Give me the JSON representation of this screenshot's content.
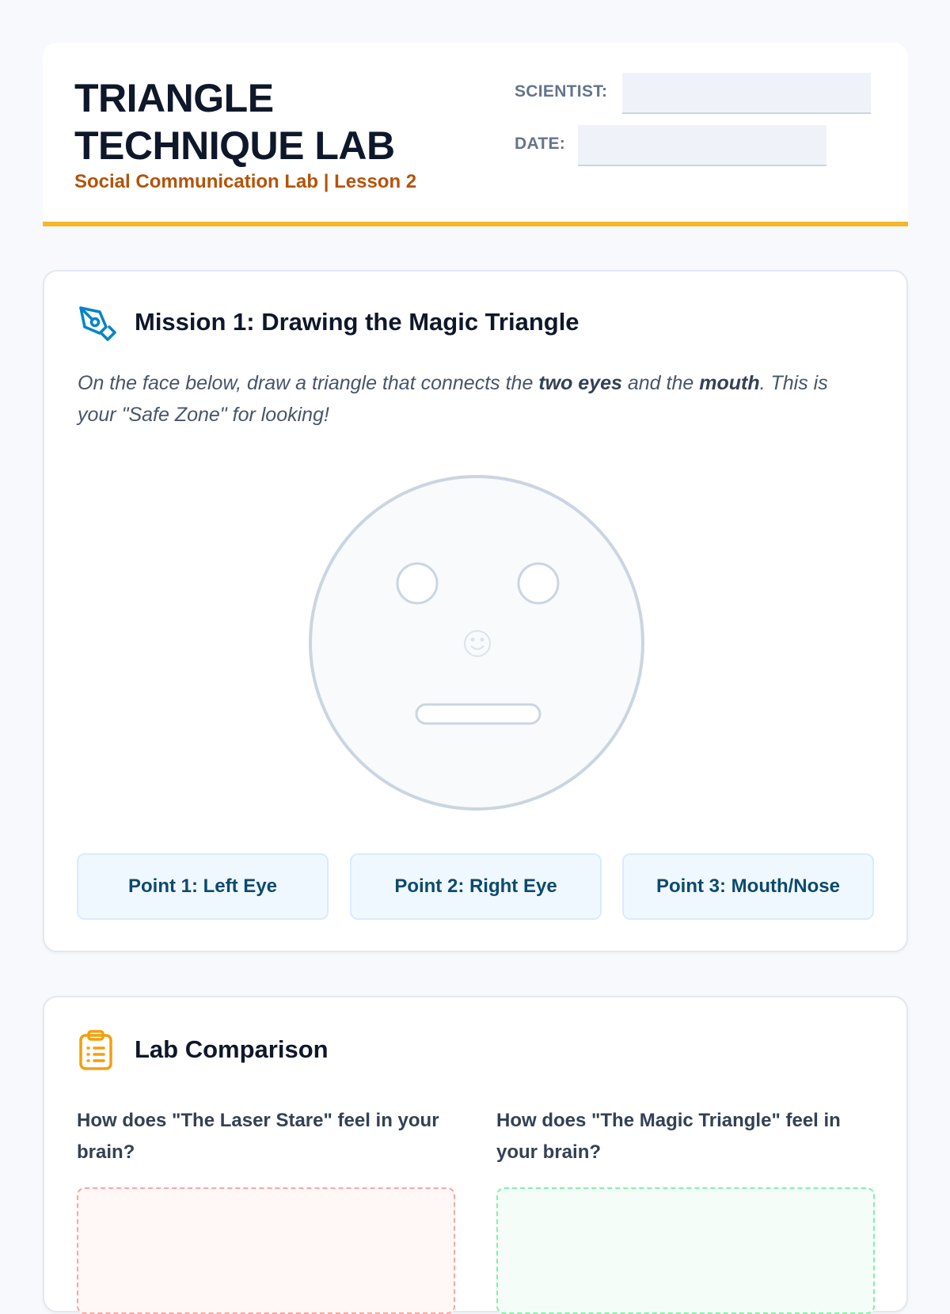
{
  "header": {
    "title_line1": "TRIANGLE",
    "title_line2": "TECHNIQUE LAB",
    "subtitle": "Social Communication Lab | Lesson 2",
    "scientist_label": "SCIENTIST:",
    "scientist_value": "",
    "date_label": "DATE:",
    "date_value": "",
    "accent_color": "#f6b72c"
  },
  "mission": {
    "icon": "pen-nib-icon",
    "title": "Mission 1: Drawing the Magic Triangle",
    "instructions": {
      "part1": "On the face below, draw a triangle that connects the ",
      "bold1": "two eyes",
      "part2": " and the ",
      "bold2": "mouth",
      "part3": ". This is your \"Safe Zone\" for looking!"
    },
    "face_icon": "face-outline",
    "nose_icon": "smile-icon",
    "points": [
      "Point 1: Left Eye",
      "Point 2: Right Eye",
      "Point 3: Mouth/Nose"
    ]
  },
  "comparison": {
    "icon": "clipboard-list-icon",
    "title": "Lab Comparison",
    "questions": [
      "How does \"The Laser Stare\" feel in your brain?",
      "How does \"The Magic Triangle\" feel in your brain?"
    ],
    "answers": [
      "",
      ""
    ],
    "left_color": "#fca5a5",
    "right_color": "#86efac"
  }
}
